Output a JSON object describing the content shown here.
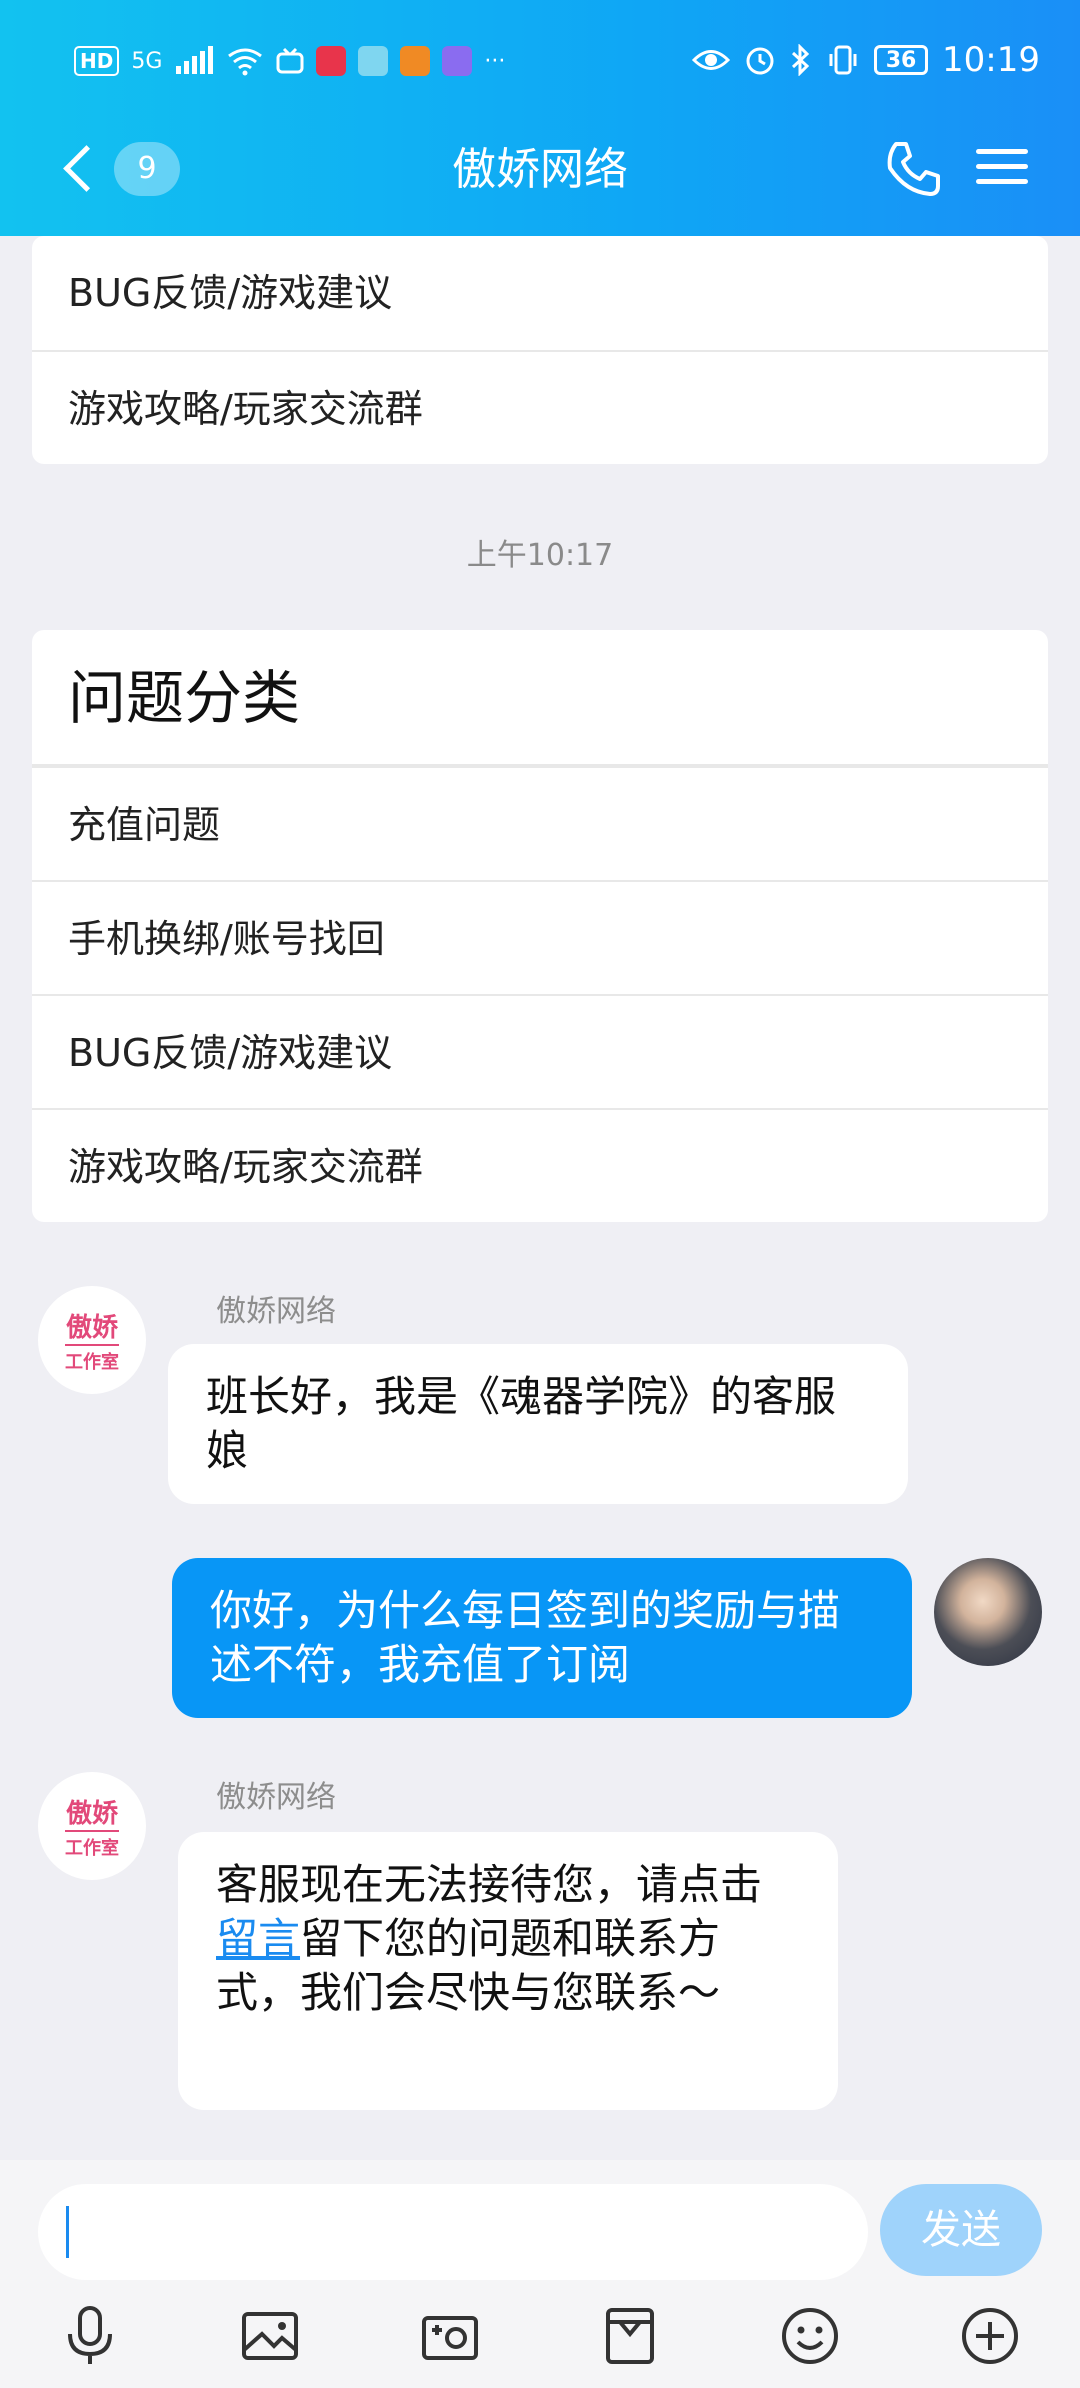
{
  "status_bar": {
    "network_badge": "HD",
    "signal_label": "5G",
    "more": "···",
    "battery": "36",
    "time": "10:19"
  },
  "header": {
    "unread_count": "9",
    "title": "傲娇网络"
  },
  "top_card": {
    "rows": [
      "BUG反馈/游戏建议",
      "游戏攻略/玩家交流群"
    ]
  },
  "timestamp": "上午10:17",
  "category_card": {
    "heading": "问题分类",
    "rows": [
      "充值问题",
      "手机换绑/账号找回",
      "BUG反馈/游戏建议",
      "游戏攻略/玩家交流群"
    ]
  },
  "messages": [
    {
      "sender": "傲娇网络",
      "text": "班长好，我是《魂器学院》的客服娘"
    },
    {
      "sender": "",
      "text": "你好，为什么每日签到的奖励与描述不符，我充值了订阅"
    },
    {
      "sender": "傲娇网络",
      "text_before": "客服现在无法接待您，请点击",
      "link": "留言",
      "text_after": "留下您的问题和联系方式，我们会尽快与您联系～"
    }
  ],
  "brand_avatar": {
    "top": "傲娇",
    "bottom": "工作室"
  },
  "composer": {
    "send_label": "发送",
    "tools": [
      "mic-icon",
      "image-icon",
      "camera-icon",
      "file-icon",
      "emoji-icon",
      "plus-icon"
    ]
  },
  "colors": {
    "accent": "#0896f6",
    "header_start": "#12c2f0",
    "header_end": "#1a8ff7",
    "send_disabled": "#9fd3fb",
    "brand_pink": "#e2497a"
  }
}
